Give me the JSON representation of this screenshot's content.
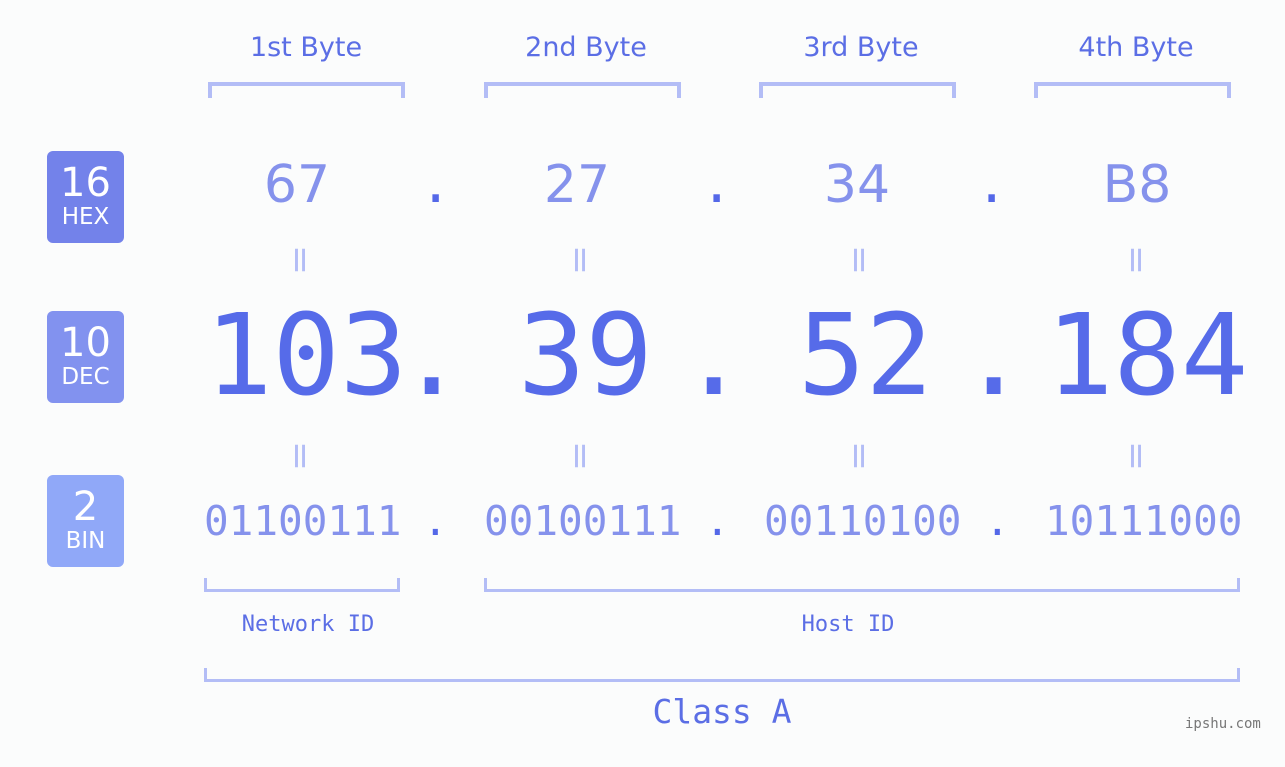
{
  "headers": [
    "1st Byte",
    "2nd Byte",
    "3rd Byte",
    "4th Byte"
  ],
  "badges": {
    "hex": {
      "base": "16",
      "label": "HEX",
      "color": "#7382ea"
    },
    "dec": {
      "base": "10",
      "label": "DEC",
      "color": "#8292ef"
    },
    "bin": {
      "base": "2",
      "label": "BIN",
      "color": "#90a8f8"
    }
  },
  "hex": [
    "67",
    "27",
    "34",
    "B8"
  ],
  "dec": [
    "103",
    "39",
    "52",
    "184"
  ],
  "bin": [
    "01100111",
    "00100111",
    "00110100",
    "10111000"
  ],
  "separator": ".",
  "equals": "=",
  "network_id_label": "Network ID",
  "host_id_label": "Host ID",
  "class_label": "Class A",
  "watermark": "ipshu.com"
}
